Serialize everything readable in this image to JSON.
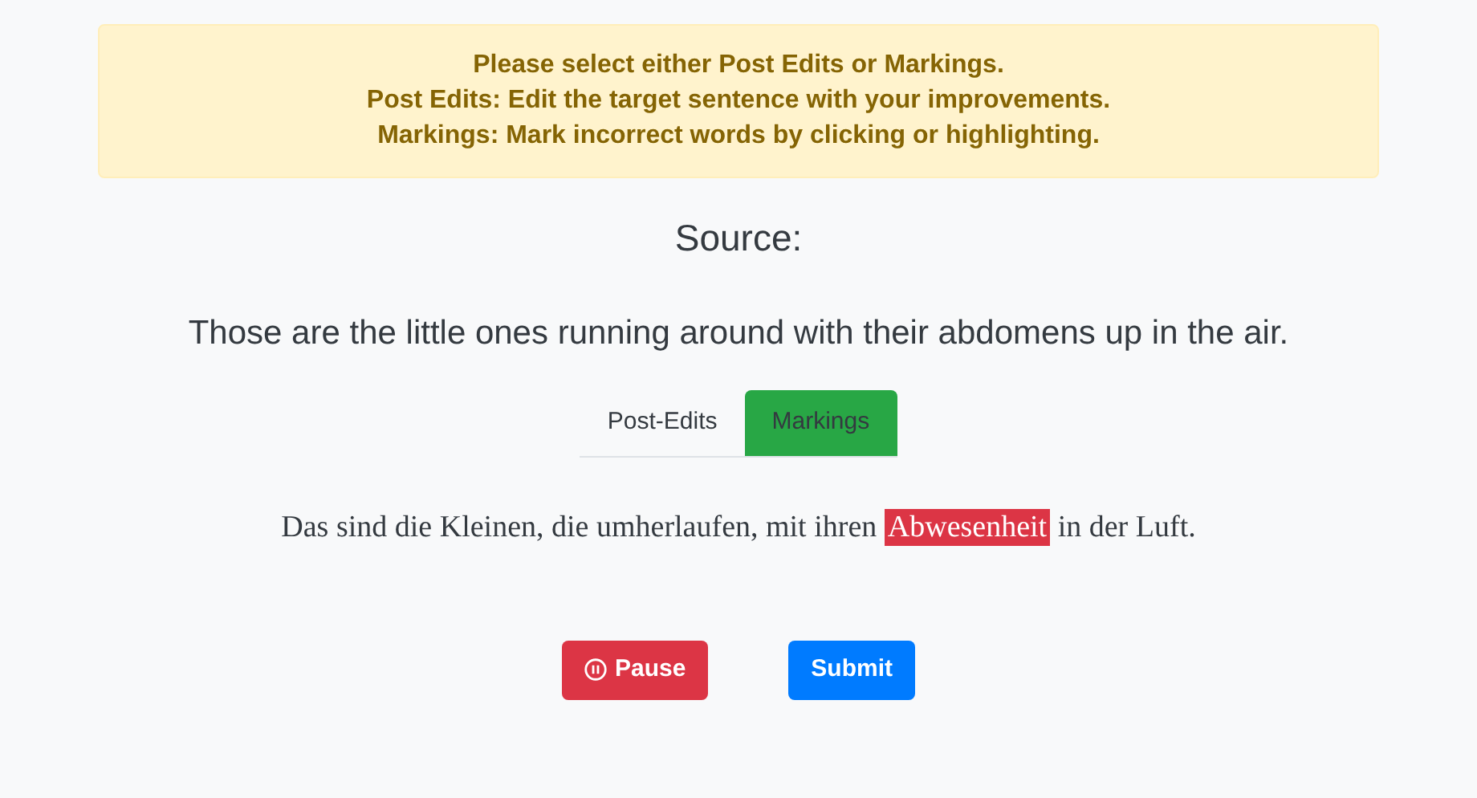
{
  "instructions": [
    "Please select either Post Edits or Markings.",
    "Post Edits: Edit the target sentence with your improvements.",
    "Markings: Mark incorrect words by clicking or highlighting."
  ],
  "source_heading": "Source:",
  "source_sentence": "Those are the little ones running around with their abdomens up in the air.",
  "tabs": [
    {
      "label": "Post-Edits",
      "selected": false
    },
    {
      "label": "Markings",
      "selected": true
    }
  ],
  "target_words": [
    {
      "text": "Das",
      "marked": false
    },
    {
      "text": "sind",
      "marked": false
    },
    {
      "text": "die",
      "marked": false
    },
    {
      "text": "Kleinen,",
      "marked": false
    },
    {
      "text": "die",
      "marked": false
    },
    {
      "text": "umherlaufen,",
      "marked": false
    },
    {
      "text": "mit",
      "marked": false
    },
    {
      "text": "ihren",
      "marked": false
    },
    {
      "text": "Abwesenheit",
      "marked": true
    },
    {
      "text": "in",
      "marked": false
    },
    {
      "text": "der",
      "marked": false
    },
    {
      "text": "Luft.",
      "marked": false
    }
  ],
  "buttons": [
    {
      "kind": "pause",
      "label": "Pause"
    },
    {
      "kind": "submit",
      "label": "Submit"
    }
  ]
}
